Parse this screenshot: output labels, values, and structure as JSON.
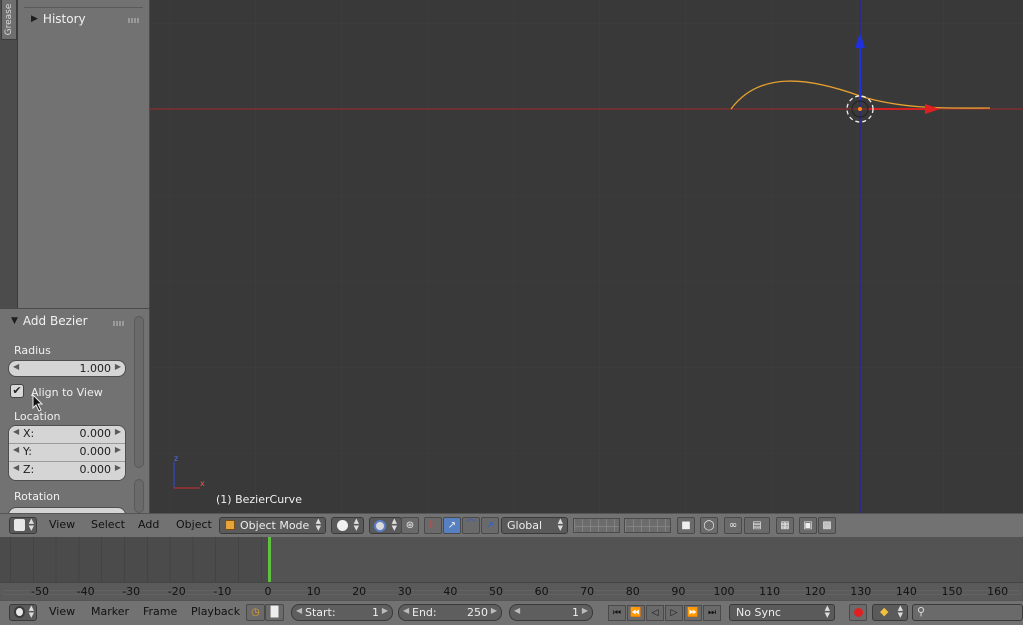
{
  "tool_shelf": {
    "tab_label": "Grease",
    "history_label": "History"
  },
  "operator": {
    "title": "Add Bezier",
    "radius_label": "Radius",
    "radius_value": "1.000",
    "align_to_view_label": "Align to View",
    "align_to_view_checked": true,
    "location_label": "Location",
    "location": [
      {
        "axis": "X:",
        "value": "0.000"
      },
      {
        "axis": "Y:",
        "value": "0.000"
      },
      {
        "axis": "Z:",
        "value": "0.000"
      }
    ],
    "rotation_label": "Rotation"
  },
  "viewport": {
    "object_label": "(1) BezierCurve",
    "colors": {
      "x_axis": "#c83030",
      "z_axis": "#2020c8",
      "curve": "#e8a020",
      "background": "#393939"
    }
  },
  "view3d_header": {
    "menus": [
      "View",
      "Select",
      "Add",
      "Object"
    ],
    "mode": "Object Mode",
    "orientation": "Global"
  },
  "timeline": {
    "ticks": [
      "-50",
      "-40",
      "-30",
      "-20",
      "-10",
      "0",
      "10",
      "20",
      "30",
      "40",
      "50",
      "60",
      "70",
      "80",
      "90",
      "100",
      "110",
      "120",
      "130",
      "140",
      "150",
      "160"
    ],
    "current_frame_marker": 0
  },
  "timeline_header": {
    "menus": [
      "View",
      "Marker",
      "Frame",
      "Playback"
    ],
    "start_label": "Start:",
    "start_value": "1",
    "end_label": "End:",
    "end_value": "250",
    "current_frame": "1",
    "sync": "No Sync"
  }
}
